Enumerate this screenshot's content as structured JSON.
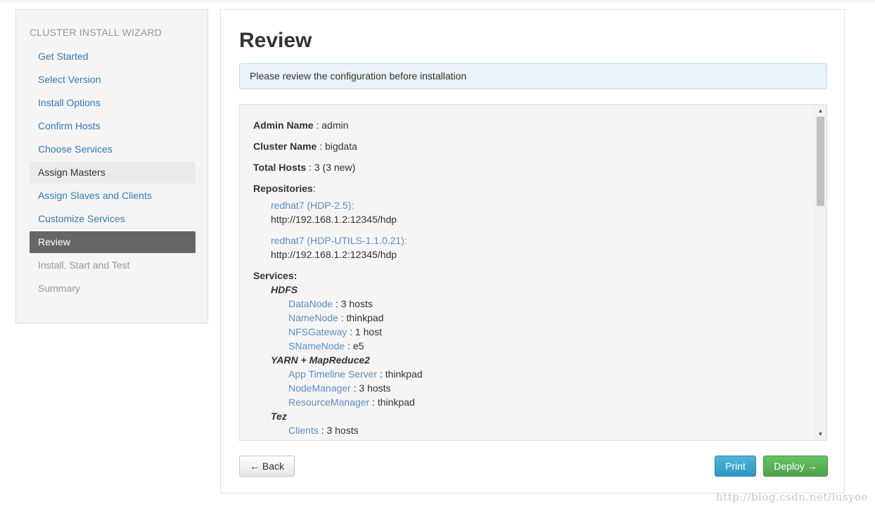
{
  "sidebar": {
    "title": "CLUSTER INSTALL WIZARD",
    "items": [
      {
        "label": "Get Started"
      },
      {
        "label": "Select Version"
      },
      {
        "label": "Install Options"
      },
      {
        "label": "Confirm Hosts"
      },
      {
        "label": "Choose Services"
      },
      {
        "label": "Assign Masters"
      },
      {
        "label": "Assign Slaves and Clients"
      },
      {
        "label": "Customize Services"
      },
      {
        "label": "Review"
      },
      {
        "label": "Install, Start and Test"
      },
      {
        "label": "Summary"
      }
    ]
  },
  "main": {
    "title": "Review",
    "alert": "Please review the configuration before installation",
    "review": {
      "admin_label": "Admin Name",
      "admin_value": "admin",
      "cluster_label": "Cluster Name",
      "cluster_value": "bigdata",
      "hosts_label": "Total Hosts",
      "hosts_value": "3 (3 new)",
      "repos_label": "Repositories",
      "separator": " : ",
      "repos": [
        {
          "name": "redhat7 (HDP-2.5):",
          "url": "http://192.168.1.2:12345/hdp"
        },
        {
          "name": "redhat7 (HDP-UTILS-1.1.0.21):",
          "url": "http://192.168.1.2:12345/hdp"
        }
      ],
      "services_label": "Services:",
      "services": [
        {
          "name": "HDFS",
          "components": [
            {
              "name": "DataNode",
              "value": "3 hosts"
            },
            {
              "name": "NameNode",
              "value": "thinkpad"
            },
            {
              "name": "NFSGateway",
              "value": "1 host"
            },
            {
              "name": "SNameNode",
              "value": "e5"
            }
          ]
        },
        {
          "name": "YARN + MapReduce2",
          "components": [
            {
              "name": "App Timeline Server",
              "value": "thinkpad"
            },
            {
              "name": "NodeManager",
              "value": "3 hosts"
            },
            {
              "name": "ResourceManager",
              "value": "thinkpad"
            }
          ]
        },
        {
          "name": "Tez",
          "components": [
            {
              "name": "Clients",
              "value": "3 hosts"
            }
          ]
        }
      ]
    },
    "buttons": {
      "back": "← Back",
      "print": "Print",
      "deploy": "Deploy →"
    }
  },
  "scroll": {
    "up_glyph": "▲",
    "down_glyph": "▼"
  },
  "watermark": "http://blog.csdn.net/lusyoe"
}
